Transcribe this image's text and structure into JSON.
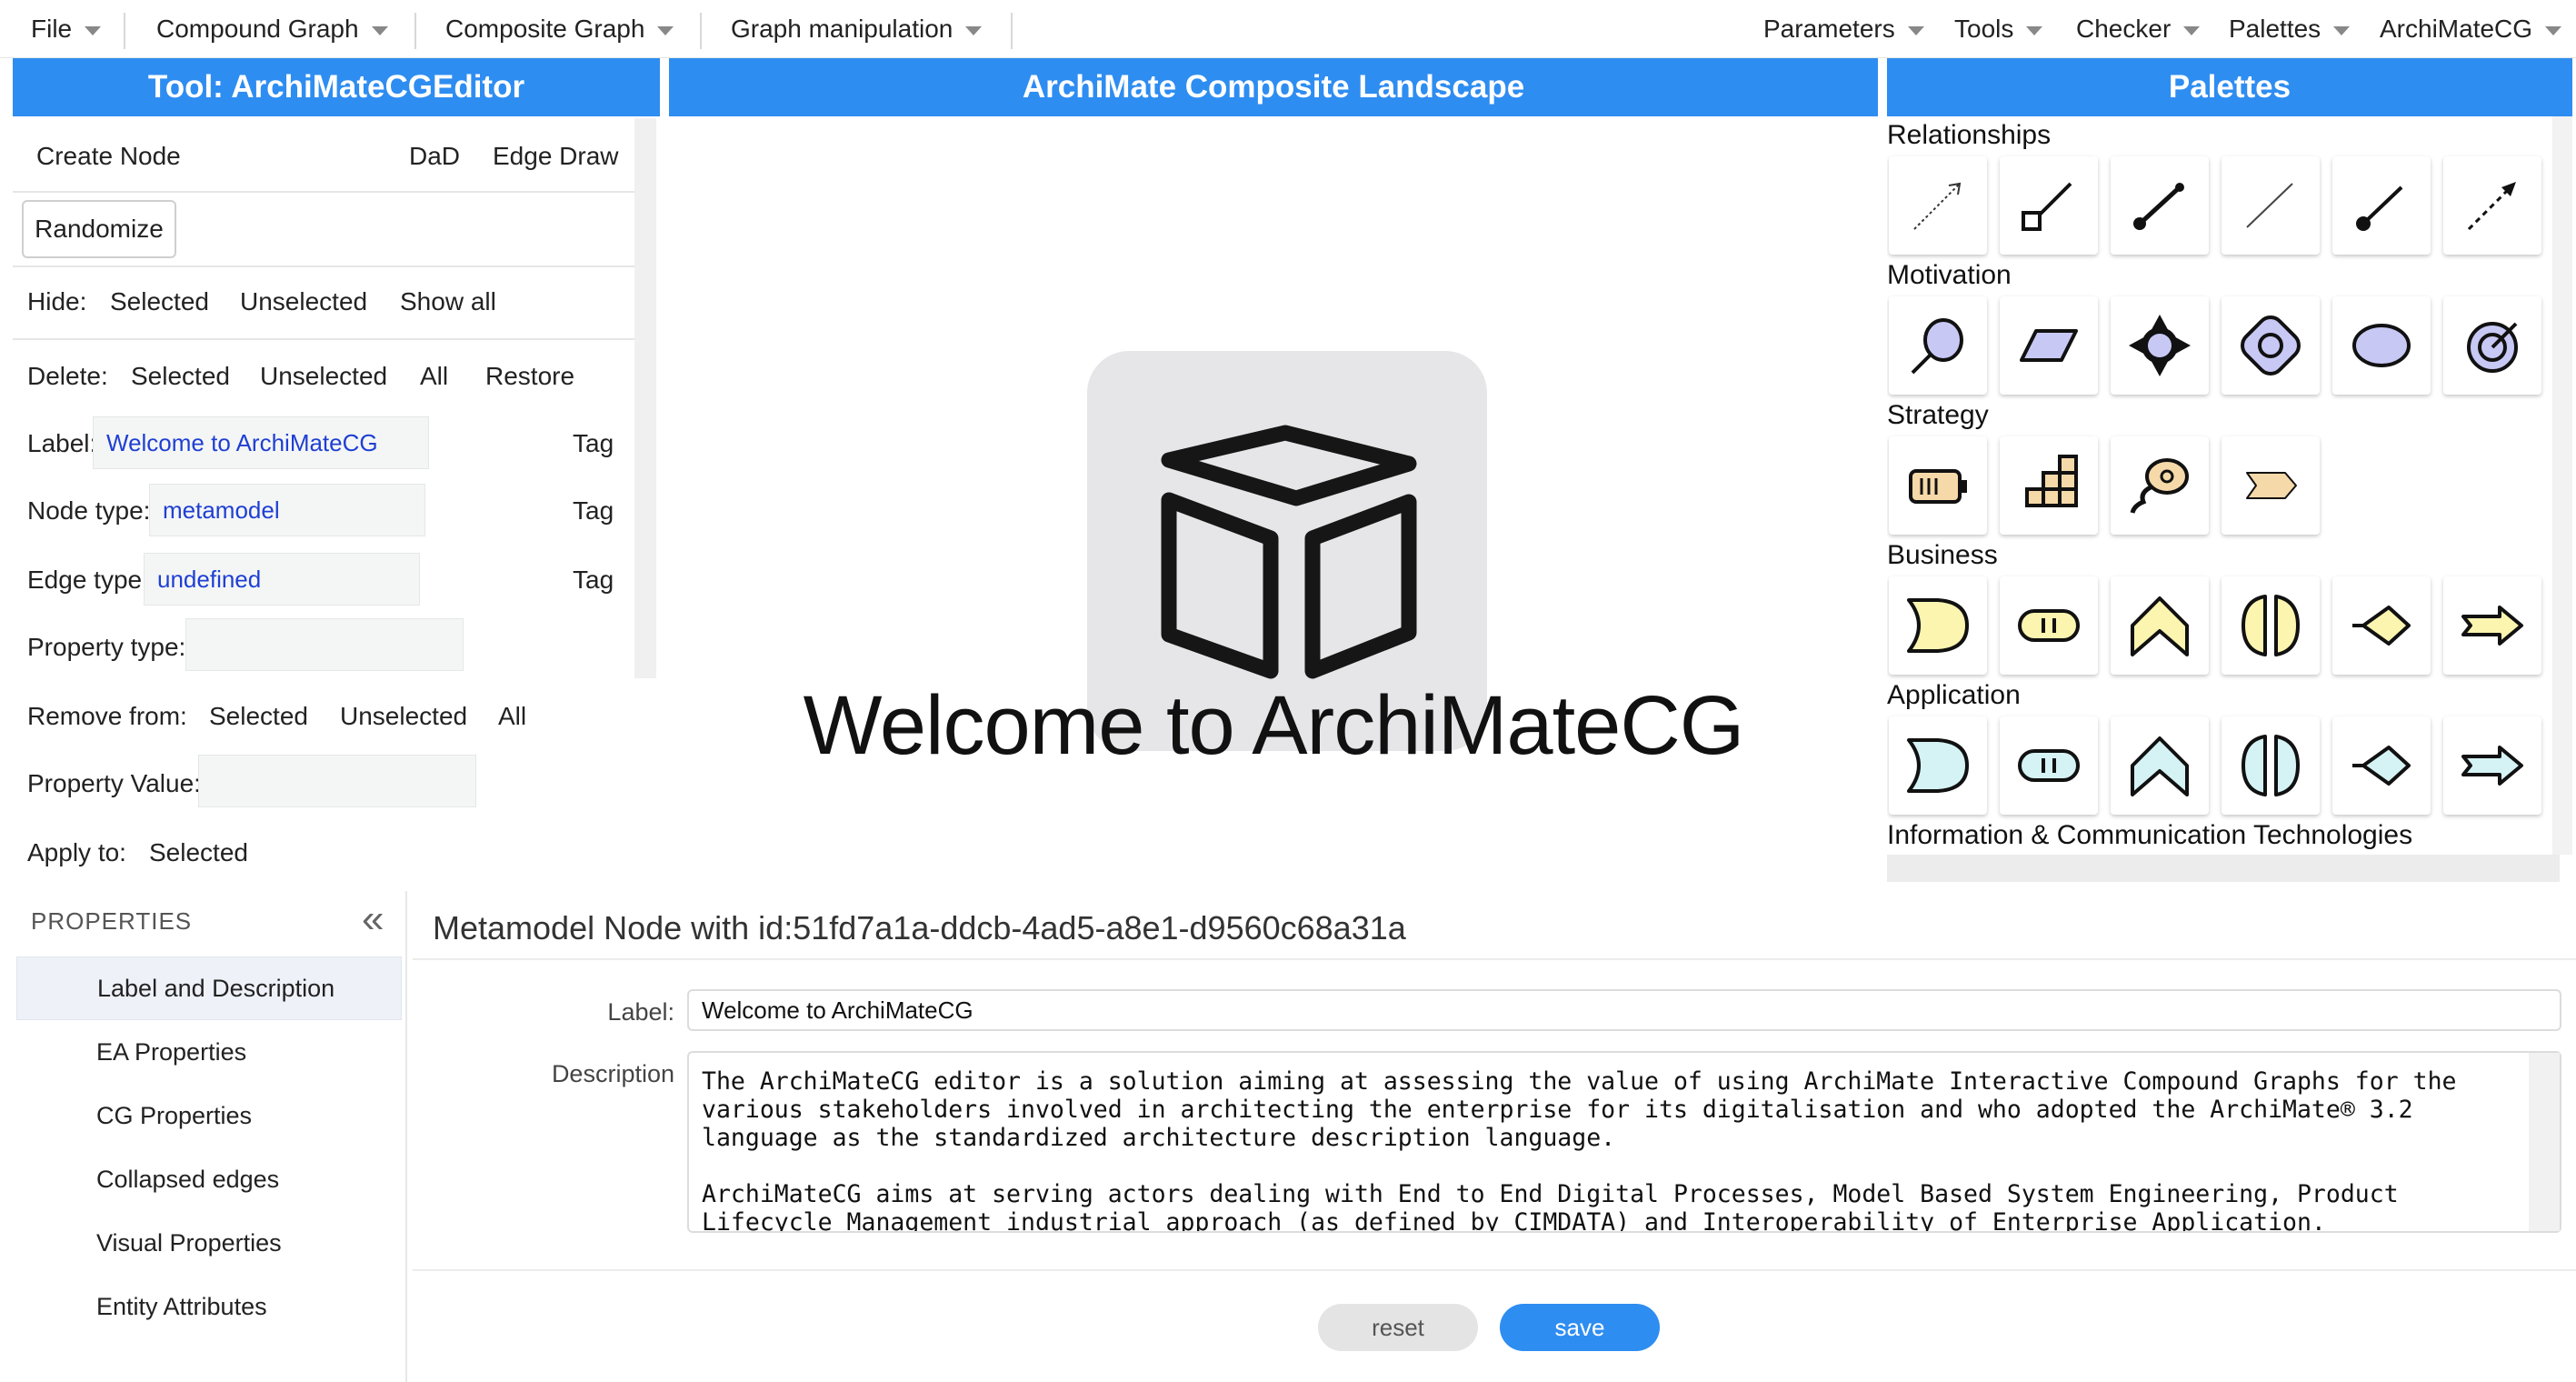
{
  "menubar": {
    "left": [
      {
        "label": "File"
      },
      {
        "label": "Compound Graph"
      },
      {
        "label": "Composite Graph"
      },
      {
        "label": "Graph manipulation"
      }
    ],
    "right": [
      {
        "label": "Parameters"
      },
      {
        "label": "Tools"
      },
      {
        "label": "Checker"
      },
      {
        "label": "Palettes"
      },
      {
        "label": "ArchiMateCG"
      }
    ]
  },
  "tool_panel": {
    "title": "Tool: ArchiMateCGEditor",
    "create_node": "Create Node",
    "dad": "DaD",
    "edge_draw": "Edge Draw",
    "randomize": "Randomize",
    "hide": {
      "label": "Hide:",
      "selected": "Selected",
      "unselected": "Unselected",
      "show_all": "Show all"
    },
    "delete": {
      "label": "Delete:",
      "selected": "Selected",
      "unselected": "Unselected",
      "all": "All",
      "restore": "Restore"
    },
    "label_field": {
      "label": "Label:",
      "value": "Welcome to ArchiMateCG",
      "tag": "Tag"
    },
    "node_type": {
      "label": "Node type:",
      "value": "metamodel",
      "tag": "Tag"
    },
    "edge_type": {
      "label": "Edge type:",
      "value": "undefined",
      "tag": "Tag"
    },
    "property_type": {
      "label": "Property type:",
      "value": ""
    },
    "remove_from": {
      "label": "Remove from:",
      "selected": "Selected",
      "unselected": "Unselected",
      "all": "All"
    },
    "property_value": {
      "label": "Property Value:",
      "value": ""
    },
    "apply_to": {
      "label": "Apply to:",
      "selected": "Selected"
    }
  },
  "canvas": {
    "title": "ArchiMate Composite Landscape",
    "welcome": "Welcome to ArchiMateCG"
  },
  "palettes": {
    "title": "Palettes",
    "categories": [
      {
        "name": "Relationships"
      },
      {
        "name": "Motivation"
      },
      {
        "name": "Strategy"
      },
      {
        "name": "Business"
      },
      {
        "name": "Application"
      },
      {
        "name": "Information & Communication Technologies"
      }
    ],
    "colors": {
      "motivation": "#c8c8f5",
      "strategy": "#f5d9a8",
      "business": "#fbf5b0",
      "application": "#d5f3f5"
    }
  },
  "properties": {
    "title": "PROPERTIES",
    "collapse_icon": "«",
    "sidebar": [
      {
        "label": "Label and Description"
      },
      {
        "label": "EA Properties"
      },
      {
        "label": "CG Properties"
      },
      {
        "label": "Collapsed edges"
      },
      {
        "label": "Visual Properties"
      },
      {
        "label": "Entity Attributes"
      }
    ],
    "heading": "Metamodel Node with id:51fd7a1a-ddcb-4ad5-a8e1-d9560c68a31a",
    "label_label": "Label:",
    "label_value": "Welcome to ArchiMateCG",
    "description_label": "Description",
    "description_value": "The ArchiMateCG editor is a solution aiming at assessing the value of using ArchiMate Interactive Compound Graphs for the\nvarious stakeholders involved in architecting the enterprise for its digitalisation and who adopted the ArchiMate® 3.2\nlanguage as the standardized architecture description language.\n\nArchiMateCG aims at serving actors dealing with End to End Digital Processes, Model Based System Engineering, Product\nLifecycle Management industrial approach (as defined by CIMDATA) and Interoperability of Enterprise Application.",
    "reset": "reset",
    "save": "save"
  }
}
